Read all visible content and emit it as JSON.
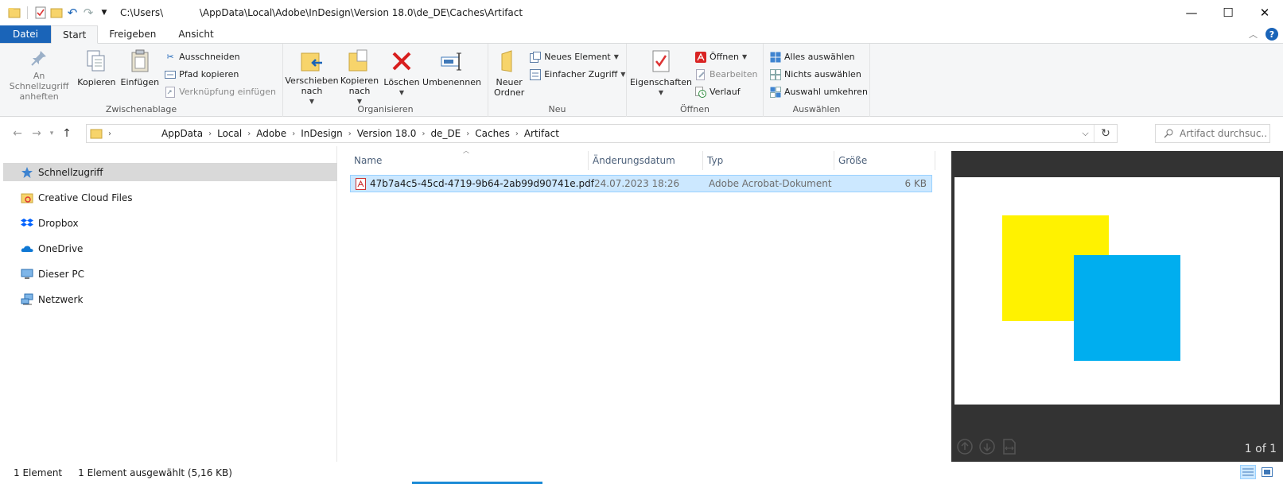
{
  "window": {
    "title_path": "C:\\Users\\            \\AppData\\Local\\Adobe\\InDesign\\Version 18.0\\de_DE\\Caches\\Artifact",
    "minimize": "—",
    "maximize": "☐",
    "close": "✕"
  },
  "tabs": {
    "file": "Datei",
    "start": "Start",
    "share": "Freigeben",
    "view": "Ansicht"
  },
  "ribbon": {
    "clipboard": {
      "label": "Zwischenablage",
      "pin": "An Schnellzugriff anheften",
      "copy": "Kopieren",
      "paste": "Einfügen",
      "cut": "Ausschneiden",
      "copy_path": "Pfad kopieren",
      "paste_shortcut": "Verknüpfung einfügen"
    },
    "organize": {
      "label": "Organisieren",
      "move_to": "Verschieben nach",
      "copy_to": "Kopieren nach",
      "delete": "Löschen",
      "rename": "Umbenennen"
    },
    "new": {
      "label": "Neu",
      "new_folder": "Neuer Ordner",
      "new_item": "Neues Element",
      "easy_access": "Einfacher Zugriff"
    },
    "open": {
      "label": "Öffnen",
      "properties": "Eigenschaften",
      "open": "Öffnen",
      "edit": "Bearbeiten",
      "history": "Verlauf"
    },
    "select": {
      "label": "Auswählen",
      "select_all": "Alles auswählen",
      "select_none": "Nichts auswählen",
      "invert": "Auswahl umkehren"
    }
  },
  "address": {
    "crumbs": [
      "AppData",
      "Local",
      "Adobe",
      "InDesign",
      "Version 18.0",
      "de_DE",
      "Caches",
      "Artifact"
    ],
    "search_placeholder": "Artifact durchsuc..."
  },
  "nav": {
    "items": [
      {
        "label": "Schnellzugriff",
        "icon": "star-icon"
      },
      {
        "label": "Creative Cloud Files",
        "icon": "creative-cloud-folder-icon"
      },
      {
        "label": "Dropbox",
        "icon": "dropbox-icon"
      },
      {
        "label": "OneDrive",
        "icon": "onedrive-cloud-icon"
      },
      {
        "label": "Dieser PC",
        "icon": "computer-icon"
      },
      {
        "label": "Netzwerk",
        "icon": "network-icon"
      }
    ]
  },
  "filelist": {
    "columns": {
      "name": "Name",
      "date": "Änderungsdatum",
      "type": "Typ",
      "size": "Größe"
    },
    "rows": [
      {
        "name": "47b7a4c5-45cd-4719-9b64-2ab99d90741e.pdf",
        "date": "24.07.2023 18:26",
        "type": "Adobe Acrobat-Dokument",
        "size": "6 KB"
      }
    ]
  },
  "preview": {
    "page_count": "1 of 1",
    "colors": {
      "yellow": "#fff200",
      "blue": "#00aeef"
    }
  },
  "status": {
    "count": "1 Element",
    "selected": "1 Element ausgewählt (5,16 KB)"
  }
}
